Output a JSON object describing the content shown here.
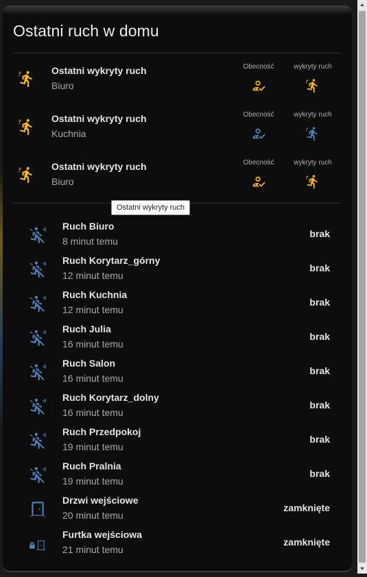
{
  "card": {
    "title": "Ostatni ruch w domu"
  },
  "motion_summary": [
    {
      "title": "Ostatni wykryty ruch",
      "room": "Biuro",
      "presence_label": "Obecność",
      "detected_label": "wykryty ruch",
      "presence_active": true,
      "detected_active": true
    },
    {
      "title": "Ostatni wykryty ruch",
      "room": "Kuchnia",
      "presence_label": "Obecność",
      "detected_label": "wykryty ruch",
      "presence_active": false,
      "detected_active": false
    },
    {
      "title": "Ostatni wykryty ruch",
      "room": "Biuro",
      "presence_label": "Obecność",
      "detected_label": "wykryty ruch",
      "presence_active": true,
      "detected_active": true
    }
  ],
  "tooltip": {
    "text": "Ostatni wykryty ruch"
  },
  "entities": [
    {
      "icon": "motion-sensor-off-icon",
      "name": "Ruch Biuro",
      "time": "8 minut temu",
      "state": "brak"
    },
    {
      "icon": "motion-sensor-off-icon",
      "name": "Ruch Korytarz_górny",
      "time": "12 minut temu",
      "state": "brak"
    },
    {
      "icon": "motion-sensor-off-icon",
      "name": "Ruch Kuchnia",
      "time": "12 minut temu",
      "state": "brak"
    },
    {
      "icon": "motion-sensor-off-icon",
      "name": "Ruch Julia",
      "time": "16 minut temu",
      "state": "brak"
    },
    {
      "icon": "motion-sensor-off-icon",
      "name": "Ruch Salon",
      "time": "16 minut temu",
      "state": "brak"
    },
    {
      "icon": "motion-sensor-off-icon",
      "name": "Ruch Korytarz_dolny",
      "time": "16 minut temu",
      "state": "brak"
    },
    {
      "icon": "motion-sensor-off-icon",
      "name": "Ruch Przedpokoj",
      "time": "19 minut temu",
      "state": "brak"
    },
    {
      "icon": "motion-sensor-off-icon",
      "name": "Ruch Pralnia",
      "time": "19 minut temu",
      "state": "brak"
    },
    {
      "icon": "door-closed-icon",
      "name": "Drzwi wejściowe",
      "time": "20 minut temu",
      "state": "zamknięte"
    },
    {
      "icon": "gate-lock-icon",
      "name": "Furtka wejściowa",
      "time": "21 minut temu",
      "state": "zamknięte"
    }
  ],
  "colors": {
    "active": "#f4b41a",
    "inactive": "#4f7fb8"
  }
}
